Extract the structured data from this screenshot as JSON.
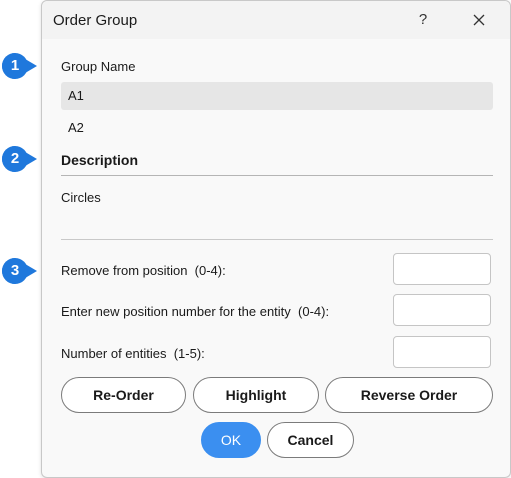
{
  "dialog": {
    "title": "Order Group",
    "help_label": "?",
    "close_icon": "close-icon"
  },
  "group_name": {
    "label": "Group Name",
    "items": [
      "A1",
      "A2"
    ],
    "selected_index": 0
  },
  "description": {
    "label": "Description",
    "value": "Circles"
  },
  "fields": {
    "remove_label": "Remove from position  (0-4):",
    "new_position_label": "Enter new position number for the entity  (0-4):",
    "count_label": "Number of entities  (1-5):"
  },
  "buttons": {
    "reorder": "Re-Order",
    "highlight": "Highlight",
    "reverse": "Reverse Order",
    "ok": "OK",
    "cancel": "Cancel"
  },
  "callouts": [
    "1",
    "2",
    "3"
  ],
  "colors": {
    "accent": "#3b8ff0",
    "callout": "#1f78dc"
  }
}
